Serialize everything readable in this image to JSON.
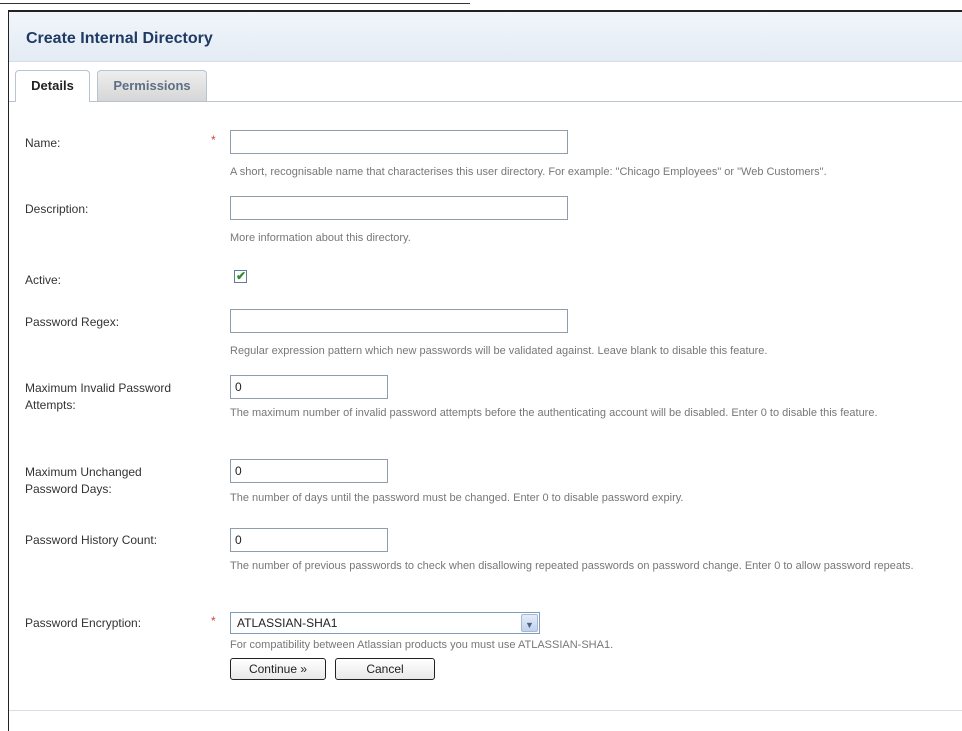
{
  "page": {
    "title": "Create Internal Directory"
  },
  "tabs": [
    {
      "label": "Details",
      "active": true
    },
    {
      "label": "Permissions",
      "active": false
    }
  ],
  "form": {
    "name": {
      "label": "Name:",
      "required": "*",
      "value": "",
      "hint": "A short, recognisable name that characterises this user directory. For example: \"Chicago Employees\" or \"Web Customers\"."
    },
    "description": {
      "label": "Description:",
      "value": "",
      "hint": "More information about this directory."
    },
    "active": {
      "label": "Active:",
      "checked": true,
      "check_glyph": "✔"
    },
    "password_regex": {
      "label": "Password Regex:",
      "value": "",
      "hint": "Regular expression pattern which new passwords will be validated against. Leave blank to disable this feature."
    },
    "max_invalid_attempts": {
      "label": "Maximum Invalid Password Attempts:",
      "value": "0",
      "hint": "The maximum number of invalid password attempts before the authenticating account will be disabled. Enter 0 to disable this feature."
    },
    "max_unchanged_days": {
      "label": "Maximum Unchanged Password Days:",
      "value": "0",
      "hint": "The number of days until the password must be changed. Enter 0 to disable password expiry."
    },
    "history_count": {
      "label": "Password History Count:",
      "value": "0",
      "hint": "The number of previous passwords to check when disallowing repeated passwords on password change. Enter 0 to allow password repeats."
    },
    "encryption": {
      "label": "Password Encryption:",
      "required": "*",
      "selected": "ATLASSIAN-SHA1",
      "arrow_glyph": "▼",
      "hint": "For compatibility between Atlassian products you must use ATLASSIAN-SHA1."
    }
  },
  "buttons": {
    "continue_label": "Continue »",
    "cancel_label": "Cancel"
  },
  "colors": {
    "title": "#1f3b63",
    "required": "#d04437",
    "hint": "#777777",
    "check": "#2e8b2e"
  }
}
